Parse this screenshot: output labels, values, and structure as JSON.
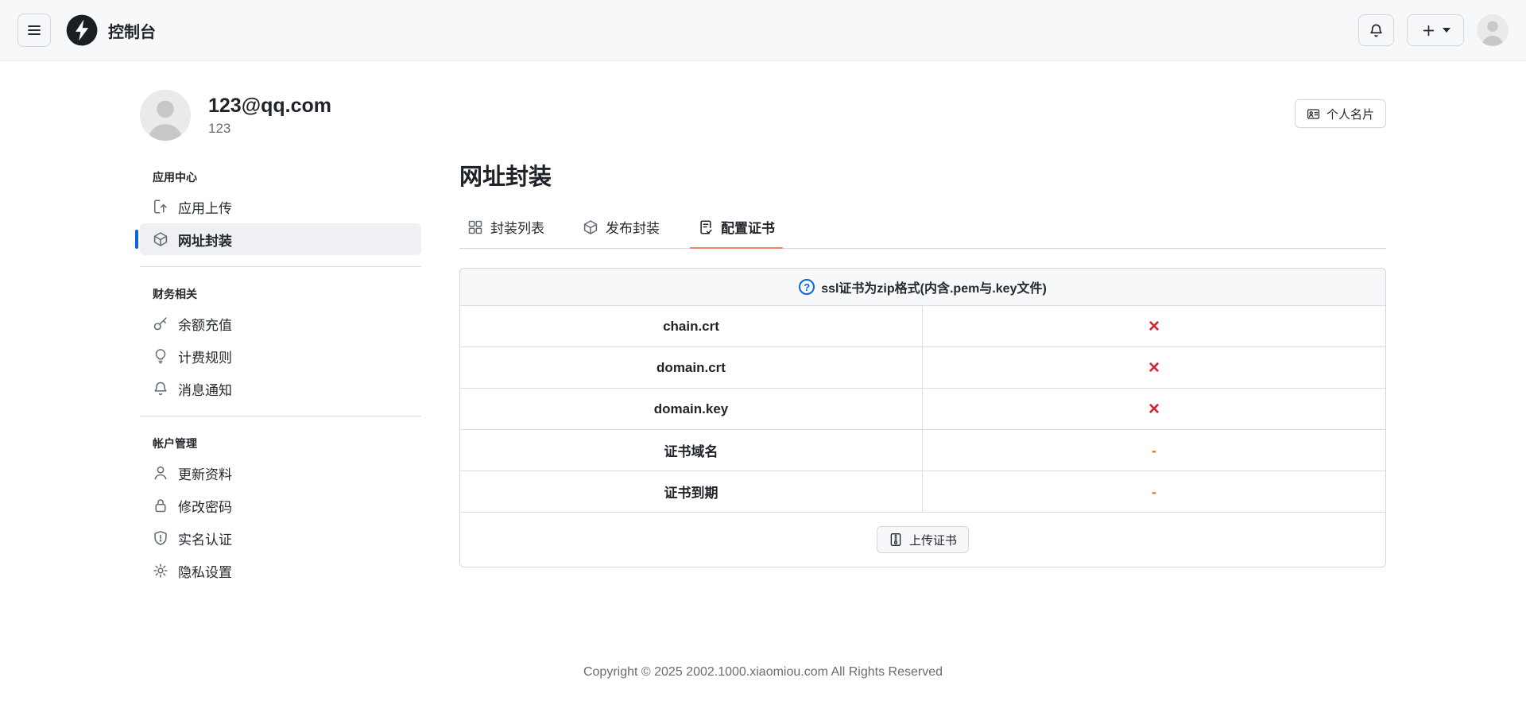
{
  "navbar": {
    "title": "控制台"
  },
  "profile": {
    "email": "123@qq.com",
    "username": "123",
    "card_button_label": "个人名片"
  },
  "sidebar": {
    "sections": [
      {
        "label": "应用中心",
        "items": [
          {
            "label": "应用上传",
            "icon": "upload-icon"
          },
          {
            "label": "网址封装",
            "icon": "package-icon",
            "active": true
          }
        ]
      },
      {
        "label": "财务相关",
        "items": [
          {
            "label": "余额充值",
            "icon": "key-icon"
          },
          {
            "label": "计费规则",
            "icon": "lightbulb-icon"
          },
          {
            "label": "消息通知",
            "icon": "bell-icon"
          }
        ]
      },
      {
        "label": "帐户管理",
        "items": [
          {
            "label": "更新资料",
            "icon": "person-icon"
          },
          {
            "label": "修改密码",
            "icon": "lock-icon"
          },
          {
            "label": "实名认证",
            "icon": "shield-icon"
          },
          {
            "label": "隐私设置",
            "icon": "gear-icon"
          }
        ]
      }
    ]
  },
  "main": {
    "title": "网址封装",
    "tabs": [
      {
        "label": "封装列表",
        "icon": "grid-icon"
      },
      {
        "label": "发布封装",
        "icon": "package-icon"
      },
      {
        "label": "配置证书",
        "icon": "file-check-icon",
        "active": true
      }
    ],
    "cert_panel": {
      "notice": "ssl证书为zip格式(内含.pem与.key文件)",
      "help_symbol": "?",
      "rows": [
        {
          "name": "chain.crt",
          "mark": "×",
          "state": "missing"
        },
        {
          "name": "domain.crt",
          "mark": "×",
          "state": "missing"
        },
        {
          "name": "domain.key",
          "mark": "×",
          "state": "missing"
        },
        {
          "name": "证书域名",
          "mark": "-",
          "state": "empty"
        },
        {
          "name": "证书到期",
          "mark": "-",
          "state": "empty"
        }
      ],
      "upload_button_label": "上传证书"
    }
  },
  "footer": {
    "copyright": "Copyright © 2025 2002.1000.xiaomiou.com All Rights Reserved"
  },
  "colors": {
    "navbar_bg": "#f6f8fa",
    "border": "#d0d7de",
    "accent_blue": "#0969da",
    "danger_red": "#d1242f",
    "warning_amber": "#bf8700",
    "tab_underline": "#f78166"
  }
}
